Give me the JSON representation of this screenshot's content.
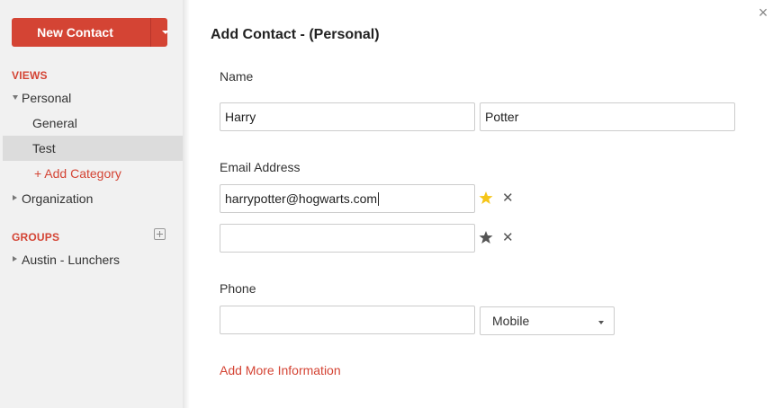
{
  "sidebar": {
    "new_contact_label": "New Contact",
    "views_label": "VIEWS",
    "groups_label": "GROUPS",
    "personal_label": "Personal",
    "general_label": "General",
    "test_label": "Test",
    "add_category_label": "+ Add Category",
    "organization_label": "Organization",
    "group_items": [
      {
        "label": "Austin - Lunchers"
      }
    ]
  },
  "form": {
    "title": "Add Contact - (Personal)",
    "name_label": "Name",
    "first_name": "Harry",
    "last_name": "Potter",
    "email_label": "Email Address",
    "email_1": "harrypotter@hogwarts.com",
    "email_2": "",
    "phone_label": "Phone",
    "phone_value": "",
    "phone_type": "Mobile",
    "more_info_label": "Add More Information"
  },
  "colors": {
    "accent": "#d44434",
    "star_primary": "#f5c518",
    "star_secondary": "#555555"
  }
}
